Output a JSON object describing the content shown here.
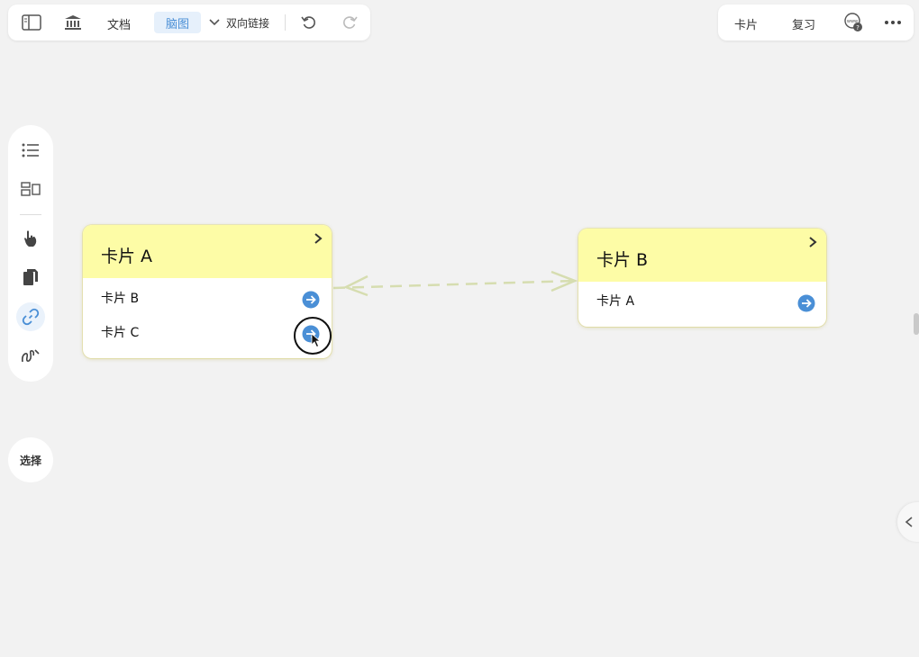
{
  "toolbar": {
    "doc_label": "文档",
    "mindmap_label": "脑图",
    "links_label": "双向链接"
  },
  "toolbar_right": {
    "card_label": "卡片",
    "review_label": "复习"
  },
  "side": {
    "select_label": "选择"
  },
  "cards": [
    {
      "title": "卡片 A",
      "rows": [
        "卡片 B",
        "卡片 C"
      ]
    },
    {
      "title": "卡片 B",
      "rows": [
        "卡片 A"
      ]
    }
  ],
  "colors": {
    "accent": "#4a8fd6",
    "card_header": "#fdfca6",
    "link_line": "#d6ddb0"
  }
}
